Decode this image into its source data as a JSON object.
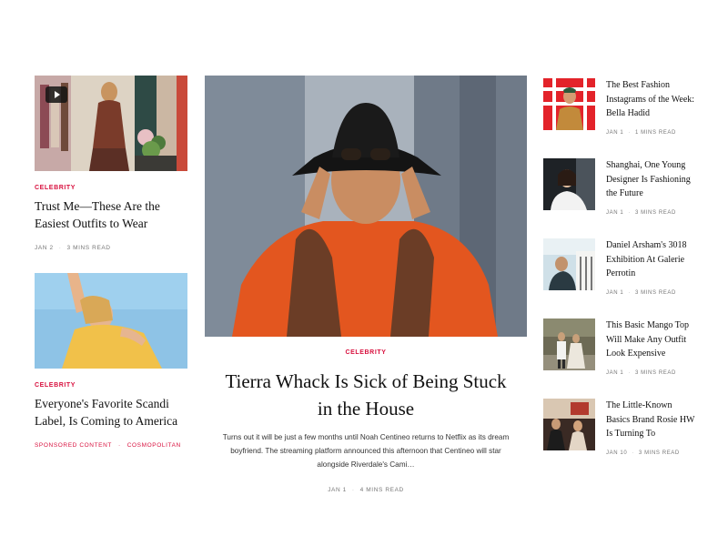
{
  "left": [
    {
      "kicker": "Celebrity",
      "title": "Trust Me—These Are the Easiest Outfits to Wear",
      "date": "Jan 2",
      "read": "3 mins read",
      "has_video": true
    },
    {
      "kicker": "Celebrity",
      "title": "Everyone's Favorite Scandi Label, Is Coming to America",
      "sponsored": "Sponsored Content",
      "sponsor": "Cosmopolitan"
    }
  ],
  "hero": {
    "kicker": "Celebrity",
    "title": "Tierra Whack Is Sick of Being Stuck in the House",
    "excerpt": "Turns out it will be just a few months until Noah Centineo returns to Netflix as its dream boyfriend. The streaming platform announced this afternoon that Centineo will star alongside Riverdale's Cami…",
    "date": "Jan 1",
    "read": "4 mins read"
  },
  "right": [
    {
      "title": "The Best Fashion Instagrams of the Week: Bella Hadid",
      "date": "Jan 1",
      "read": "1 mins read"
    },
    {
      "title": "Shanghai, One Young Designer Is Fashioning the Future",
      "date": "Jan 1",
      "read": "3 mins read"
    },
    {
      "title": "Daniel Arsham's 3018 Exhibition At Galerie Perrotin",
      "date": "Jan 1",
      "read": "3 mins read"
    },
    {
      "title": "This Basic Mango Top Will Make Any Outfit Look Expensive",
      "date": "Jan 1",
      "read": "3 mins read"
    },
    {
      "title": "The Little-Known Basics Brand Rosie HW Is Turning To",
      "date": "Jan 10",
      "read": "3 mins read"
    }
  ],
  "colors": {
    "accent": "#d8103e",
    "meta": "#777777",
    "text": "#111111"
  },
  "icons": {
    "video": "play-icon"
  }
}
